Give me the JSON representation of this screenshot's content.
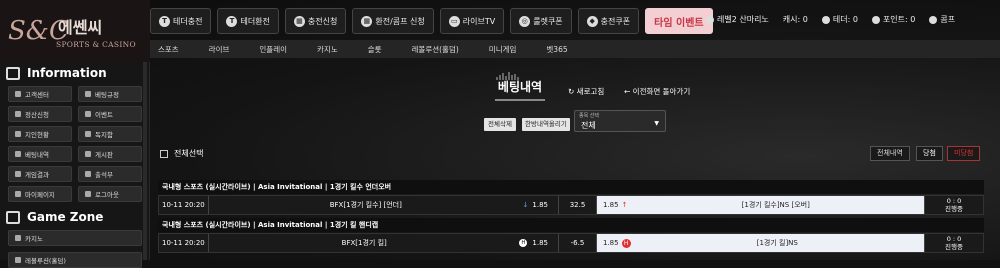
{
  "brand": {
    "mark": "S&C",
    "name_ko": "에쎈씨",
    "name_en": "SPORTS & CASINO"
  },
  "topnav": [
    {
      "icon": "T",
      "label": "테더충전"
    },
    {
      "icon": "T",
      "label": "테더환전"
    },
    {
      "icon": "▦",
      "label": "충전신청"
    },
    {
      "icon": "▦",
      "label": "환전/콤프 신청"
    },
    {
      "icon": "▭",
      "label": "라이브TV"
    },
    {
      "icon": "◎",
      "label": "룰렛쿠폰"
    },
    {
      "icon": "◆",
      "label": "충전쿠폰"
    }
  ],
  "event_button": "타임 이벤트",
  "user": {
    "level": "레벨2 산마리노",
    "cash": "캐시: 0",
    "tether": "테더: 0",
    "points": "포인트: 0",
    "comp": "콤프"
  },
  "subnav": [
    "스포츠",
    "라이브",
    "인플레이",
    "카지노",
    "슬롯",
    "레볼루션(홀덤)",
    "미니게임",
    "벳365"
  ],
  "sidebar": {
    "info_title": "Information",
    "info_items": [
      "고객센터",
      "베팅규정",
      "정산신청",
      "이벤트",
      "지인현황",
      "독지함",
      "베팅내역",
      "게시판",
      "게임결과",
      "출석부",
      "마이페이지",
      "로그아웃"
    ],
    "game_title": "Game Zone",
    "game_items": [
      "카지노",
      "레볼루션(홀덤)"
    ]
  },
  "main": {
    "title": "베팅내역",
    "reload": "새로고침",
    "back": "이전화면 돌아가기",
    "btn_delete": "전체삭제",
    "btn_cancel": "한방내역올리기",
    "select": {
      "label": "종목 선택",
      "value": "전체"
    },
    "check_all": "전체선택",
    "filters": [
      "전체내역",
      "당첨",
      "미당첨"
    ],
    "bets": [
      {
        "header": "국내형 스포츠 (실시간라이브) | Asia Invitational | 1경기 킬수 언더오버",
        "time": "10-11 20:20",
        "match": "BFX[1경기 킬수] [언더]",
        "odds_left": "1.85",
        "line": "32.5",
        "odds_sel": "1.85",
        "selection": "[1경기 킬수]NS [오버]",
        "score": "0 : 0",
        "status": "진행중",
        "flag": "↑"
      },
      {
        "header": "국내형 스포츠 (실시간라이브) | Asia Invitational | 1경기 킬 핸디캡",
        "time": "10-11 20:20",
        "match": "BFX[1경기 킬]",
        "odds_left": "1.85",
        "line": "-6.5",
        "odds_sel": "1.85",
        "selection": "[1경기 킬]NS",
        "score": "0 : 0",
        "status": "진행중",
        "flag": "H"
      }
    ]
  }
}
